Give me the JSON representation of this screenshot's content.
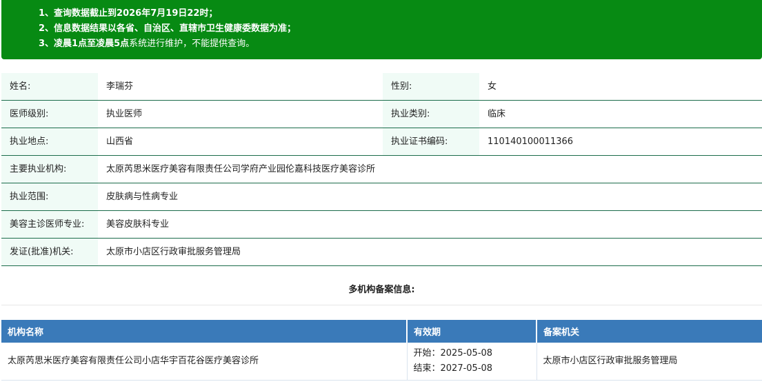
{
  "notice": {
    "line1": "1、查询数据截止到2026年7月19日22时；",
    "line2": "2、信息数据结果以各省、自治区、直辖市卫生健康委数据为准；",
    "line3_bold": "3、凌晨1点至凌晨5点",
    "line3_rest": "系统进行维护，不能提供查询。"
  },
  "profile": {
    "name_label": "姓名:",
    "name": "李瑞芬",
    "gender_label": "性别:",
    "gender": "女",
    "level_label": "医师级别:",
    "level": "执业医师",
    "category_label": "执业类别:",
    "category": "临床",
    "location_label": "执业地点:",
    "location": "山西省",
    "cert_label": "执业证书编码:",
    "cert": "110140100011366",
    "org_label": "主要执业机构:",
    "org": "太原芮思米医疗美容有限责任公司学府产业园伦嘉科技医疗美容诊所",
    "scope_label": "执业范围:",
    "scope": "皮肤病与性病专业",
    "cosmetic_label": "美容主诊医师专业:",
    "cosmetic": "美容皮肤科专业",
    "issuer_label": "发证(批准)机关:",
    "issuer": "太原市小店区行政审批服务管理局"
  },
  "multi": {
    "title": "多机构备案信息:",
    "headers": [
      "机构名称",
      "有效期",
      "备案机关"
    ],
    "rows": [
      {
        "org": "太原芮思米医疗美容有限责任公司小店华宇百花谷医疗美容诊所",
        "start": "开始：2025-05-08",
        "end": "结束：2027-05-08",
        "authority": "太原市小店区行政审批服务管理局"
      }
    ]
  }
}
